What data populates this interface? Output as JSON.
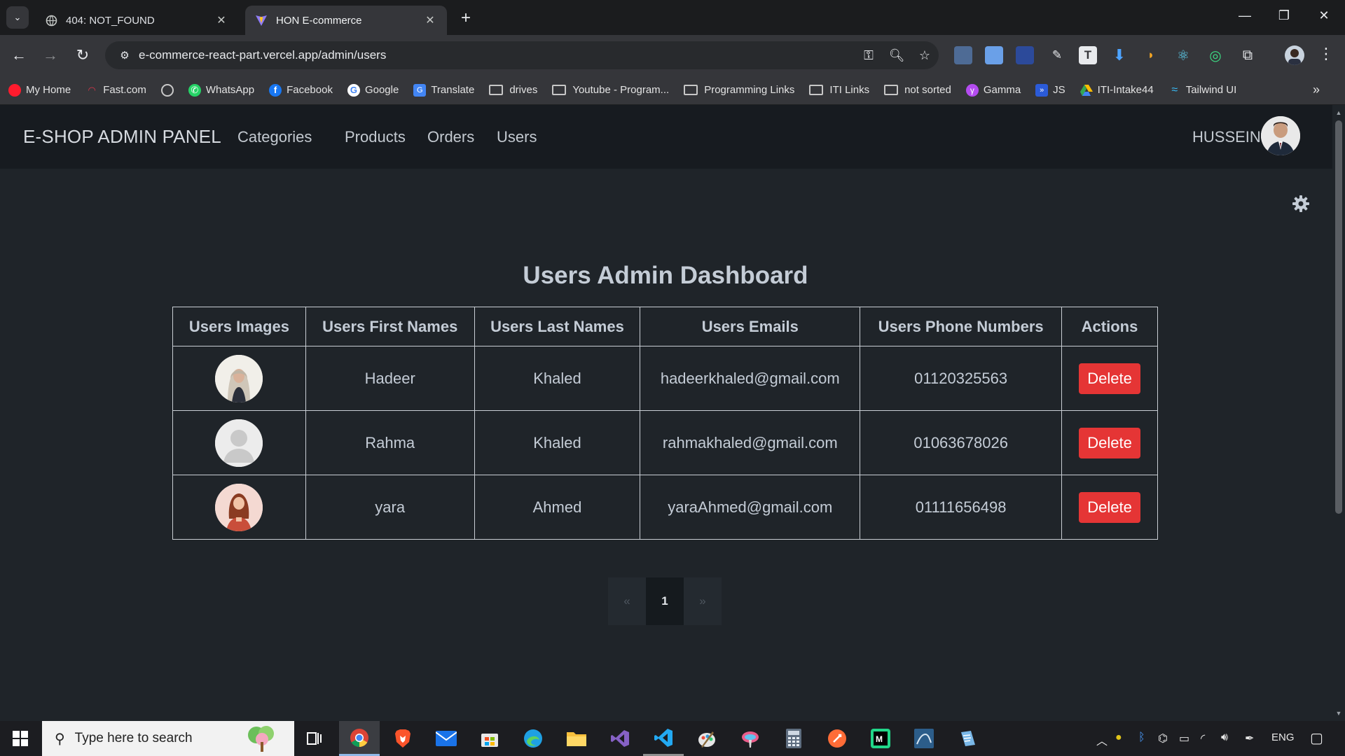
{
  "browser": {
    "tabs": [
      {
        "title": "404: NOT_FOUND",
        "active": false
      },
      {
        "title": "HON E-commerce",
        "active": true
      }
    ],
    "url": "e-commerce-react-part.vercel.app/admin/users",
    "bookmarks": [
      {
        "label": "My Home",
        "icon": "opera-icon",
        "type": "site"
      },
      {
        "label": "Fast.com",
        "icon": "speedometer-icon",
        "type": "site"
      },
      {
        "label": "",
        "icon": "chatgpt-icon",
        "type": "site"
      },
      {
        "label": "WhatsApp",
        "icon": "whatsapp-icon",
        "type": "site"
      },
      {
        "label": "Facebook",
        "icon": "facebook-icon",
        "type": "site"
      },
      {
        "label": "Google",
        "icon": "google-icon",
        "type": "site"
      },
      {
        "label": "Translate",
        "icon": "translate-icon",
        "type": "site"
      },
      {
        "label": "drives",
        "icon": "folder-icon",
        "type": "folder"
      },
      {
        "label": "Youtube - Program...",
        "icon": "folder-icon",
        "type": "folder"
      },
      {
        "label": "Programming Links",
        "icon": "folder-icon",
        "type": "folder"
      },
      {
        "label": "ITI Links",
        "icon": "folder-icon",
        "type": "folder"
      },
      {
        "label": "not sorted",
        "icon": "folder-icon",
        "type": "folder"
      },
      {
        "label": "Gamma",
        "icon": "gamma-icon",
        "type": "site"
      },
      {
        "label": "JS",
        "icon": "js-icon",
        "type": "site"
      },
      {
        "label": "ITI-Intake44",
        "icon": "google-drive-icon",
        "type": "site"
      },
      {
        "label": "Tailwind UI",
        "icon": "tailwind-icon",
        "type": "site"
      }
    ]
  },
  "app": {
    "brand": "E-SHOP ADMIN PANEL",
    "nav": [
      "Categories",
      "Products",
      "Orders",
      "Users"
    ],
    "user_name": "HUSSEIN",
    "title": "Users Admin Dashboard",
    "table": {
      "headers": [
        "Users Images",
        "Users First Names",
        "Users Last Names",
        "Users Emails",
        "Users Phone Numbers",
        "Actions"
      ],
      "rows": [
        {
          "first": "Hadeer",
          "last": "Khaled",
          "email": "hadeerkhaled@gmail.com",
          "phone": "01120325563",
          "action": "Delete",
          "avatar": "hijab-woman-photo"
        },
        {
          "first": "Rahma",
          "last": "Khaled",
          "email": "rahmakhaled@gmail.com",
          "phone": "01063678026",
          "action": "Delete",
          "avatar": "default-user-placeholder"
        },
        {
          "first": "yara",
          "last": "Ahmed",
          "email": "yaraAhmed@gmail.com",
          "phone": "01111656498",
          "action": "Delete",
          "avatar": "illustrated-woman"
        }
      ]
    },
    "pagination": {
      "prev": "«",
      "current": "1",
      "next": "»"
    }
  },
  "taskbar": {
    "search_placeholder": "Type here to search",
    "language": "ENG"
  },
  "colors": {
    "page_bg": "#1f2429",
    "navbar_bg": "#171b20",
    "danger": "#e53535",
    "text": "#c4ccd6"
  }
}
